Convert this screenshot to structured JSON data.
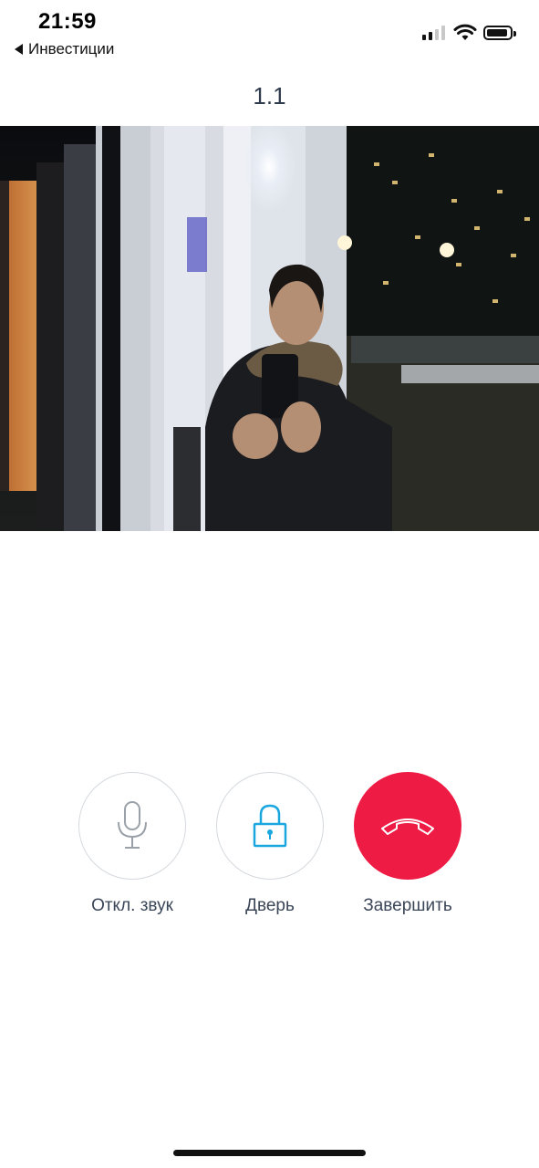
{
  "status_bar": {
    "time": "21:59",
    "back_label": "Инвестиции",
    "icons": [
      "cellular-signal-icon",
      "wifi-icon",
      "battery-icon"
    ]
  },
  "call": {
    "title": "1.1",
    "video_description": "camera-feed"
  },
  "controls": {
    "mute_label": "Откл. звук",
    "door_label": "Дверь",
    "end_label": "Завершить"
  },
  "colors": {
    "end_call": "#ee1b45",
    "door_icon": "#1aa7e0",
    "mic_icon": "#9aa1a9",
    "title_text": "#2f3b4c"
  }
}
